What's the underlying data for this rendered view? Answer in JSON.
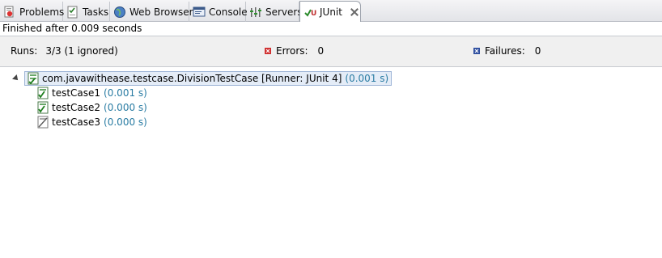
{
  "tabs": [
    {
      "label": "Problems",
      "icon": "problems-icon"
    },
    {
      "label": "Tasks",
      "icon": "tasks-icon"
    },
    {
      "label": "Web Browser",
      "icon": "web-browser-icon"
    },
    {
      "label": "Console",
      "icon": "console-icon"
    },
    {
      "label": "Servers",
      "icon": "servers-icon"
    },
    {
      "label": "JUnit",
      "icon": "junit-icon",
      "active": true
    }
  ],
  "status": "Finished after 0.009 seconds",
  "counters": {
    "runs_label": "Runs:",
    "runs_value": "3/3 (1 ignored)",
    "errors_label": "Errors:",
    "errors_value": "0",
    "failures_label": "Failures:",
    "failures_value": "0"
  },
  "tree": {
    "suite": {
      "name": "com.javawithease.testcase.DivisionTestCase [Runner: JUnit 4]",
      "time": "(0.001 s)",
      "icon": "suite-passed-icon"
    },
    "tests": [
      {
        "name": "testCase1",
        "time": "(0.001 s)",
        "status": "passed",
        "icon": "test-passed-icon"
      },
      {
        "name": "testCase2",
        "time": "(0.000 s)",
        "status": "passed",
        "icon": "test-passed-icon"
      },
      {
        "name": "testCase3",
        "time": "(0.000 s)",
        "status": "ignored",
        "icon": "test-ignored-icon"
      }
    ]
  },
  "colors": {
    "time_text": "#2a7ca3",
    "pass_green": "#3a9a3a",
    "error_red": "#d03030",
    "failure_blue": "#3050a0",
    "selection": "#e4ecf7"
  }
}
